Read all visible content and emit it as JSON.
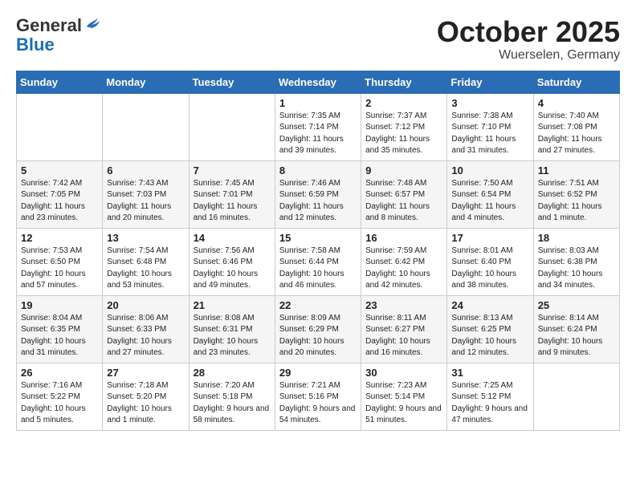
{
  "logo": {
    "general": "General",
    "blue": "Blue"
  },
  "title": "October 2025",
  "location": "Wuerselen, Germany",
  "days_header": [
    "Sunday",
    "Monday",
    "Tuesday",
    "Wednesday",
    "Thursday",
    "Friday",
    "Saturday"
  ],
  "weeks": [
    [
      {
        "day": "",
        "info": ""
      },
      {
        "day": "",
        "info": ""
      },
      {
        "day": "",
        "info": ""
      },
      {
        "day": "1",
        "info": "Sunrise: 7:35 AM\nSunset: 7:14 PM\nDaylight: 11 hours\nand 39 minutes."
      },
      {
        "day": "2",
        "info": "Sunrise: 7:37 AM\nSunset: 7:12 PM\nDaylight: 11 hours\nand 35 minutes."
      },
      {
        "day": "3",
        "info": "Sunrise: 7:38 AM\nSunset: 7:10 PM\nDaylight: 11 hours\nand 31 minutes."
      },
      {
        "day": "4",
        "info": "Sunrise: 7:40 AM\nSunset: 7:08 PM\nDaylight: 11 hours\nand 27 minutes."
      }
    ],
    [
      {
        "day": "5",
        "info": "Sunrise: 7:42 AM\nSunset: 7:05 PM\nDaylight: 11 hours\nand 23 minutes."
      },
      {
        "day": "6",
        "info": "Sunrise: 7:43 AM\nSunset: 7:03 PM\nDaylight: 11 hours\nand 20 minutes."
      },
      {
        "day": "7",
        "info": "Sunrise: 7:45 AM\nSunset: 7:01 PM\nDaylight: 11 hours\nand 16 minutes."
      },
      {
        "day": "8",
        "info": "Sunrise: 7:46 AM\nSunset: 6:59 PM\nDaylight: 11 hours\nand 12 minutes."
      },
      {
        "day": "9",
        "info": "Sunrise: 7:48 AM\nSunset: 6:57 PM\nDaylight: 11 hours\nand 8 minutes."
      },
      {
        "day": "10",
        "info": "Sunrise: 7:50 AM\nSunset: 6:54 PM\nDaylight: 11 hours\nand 4 minutes."
      },
      {
        "day": "11",
        "info": "Sunrise: 7:51 AM\nSunset: 6:52 PM\nDaylight: 11 hours\nand 1 minute."
      }
    ],
    [
      {
        "day": "12",
        "info": "Sunrise: 7:53 AM\nSunset: 6:50 PM\nDaylight: 10 hours\nand 57 minutes."
      },
      {
        "day": "13",
        "info": "Sunrise: 7:54 AM\nSunset: 6:48 PM\nDaylight: 10 hours\nand 53 minutes."
      },
      {
        "day": "14",
        "info": "Sunrise: 7:56 AM\nSunset: 6:46 PM\nDaylight: 10 hours\nand 49 minutes."
      },
      {
        "day": "15",
        "info": "Sunrise: 7:58 AM\nSunset: 6:44 PM\nDaylight: 10 hours\nand 46 minutes."
      },
      {
        "day": "16",
        "info": "Sunrise: 7:59 AM\nSunset: 6:42 PM\nDaylight: 10 hours\nand 42 minutes."
      },
      {
        "day": "17",
        "info": "Sunrise: 8:01 AM\nSunset: 6:40 PM\nDaylight: 10 hours\nand 38 minutes."
      },
      {
        "day": "18",
        "info": "Sunrise: 8:03 AM\nSunset: 6:38 PM\nDaylight: 10 hours\nand 34 minutes."
      }
    ],
    [
      {
        "day": "19",
        "info": "Sunrise: 8:04 AM\nSunset: 6:35 PM\nDaylight: 10 hours\nand 31 minutes."
      },
      {
        "day": "20",
        "info": "Sunrise: 8:06 AM\nSunset: 6:33 PM\nDaylight: 10 hours\nand 27 minutes."
      },
      {
        "day": "21",
        "info": "Sunrise: 8:08 AM\nSunset: 6:31 PM\nDaylight: 10 hours\nand 23 minutes."
      },
      {
        "day": "22",
        "info": "Sunrise: 8:09 AM\nSunset: 6:29 PM\nDaylight: 10 hours\nand 20 minutes."
      },
      {
        "day": "23",
        "info": "Sunrise: 8:11 AM\nSunset: 6:27 PM\nDaylight: 10 hours\nand 16 minutes."
      },
      {
        "day": "24",
        "info": "Sunrise: 8:13 AM\nSunset: 6:25 PM\nDaylight: 10 hours\nand 12 minutes."
      },
      {
        "day": "25",
        "info": "Sunrise: 8:14 AM\nSunset: 6:24 PM\nDaylight: 10 hours\nand 9 minutes."
      }
    ],
    [
      {
        "day": "26",
        "info": "Sunrise: 7:16 AM\nSunset: 5:22 PM\nDaylight: 10 hours\nand 5 minutes."
      },
      {
        "day": "27",
        "info": "Sunrise: 7:18 AM\nSunset: 5:20 PM\nDaylight: 10 hours\nand 1 minute."
      },
      {
        "day": "28",
        "info": "Sunrise: 7:20 AM\nSunset: 5:18 PM\nDaylight: 9 hours\nand 58 minutes."
      },
      {
        "day": "29",
        "info": "Sunrise: 7:21 AM\nSunset: 5:16 PM\nDaylight: 9 hours\nand 54 minutes."
      },
      {
        "day": "30",
        "info": "Sunrise: 7:23 AM\nSunset: 5:14 PM\nDaylight: 9 hours\nand 51 minutes."
      },
      {
        "day": "31",
        "info": "Sunrise: 7:25 AM\nSunset: 5:12 PM\nDaylight: 9 hours\nand 47 minutes."
      },
      {
        "day": "",
        "info": ""
      }
    ]
  ]
}
